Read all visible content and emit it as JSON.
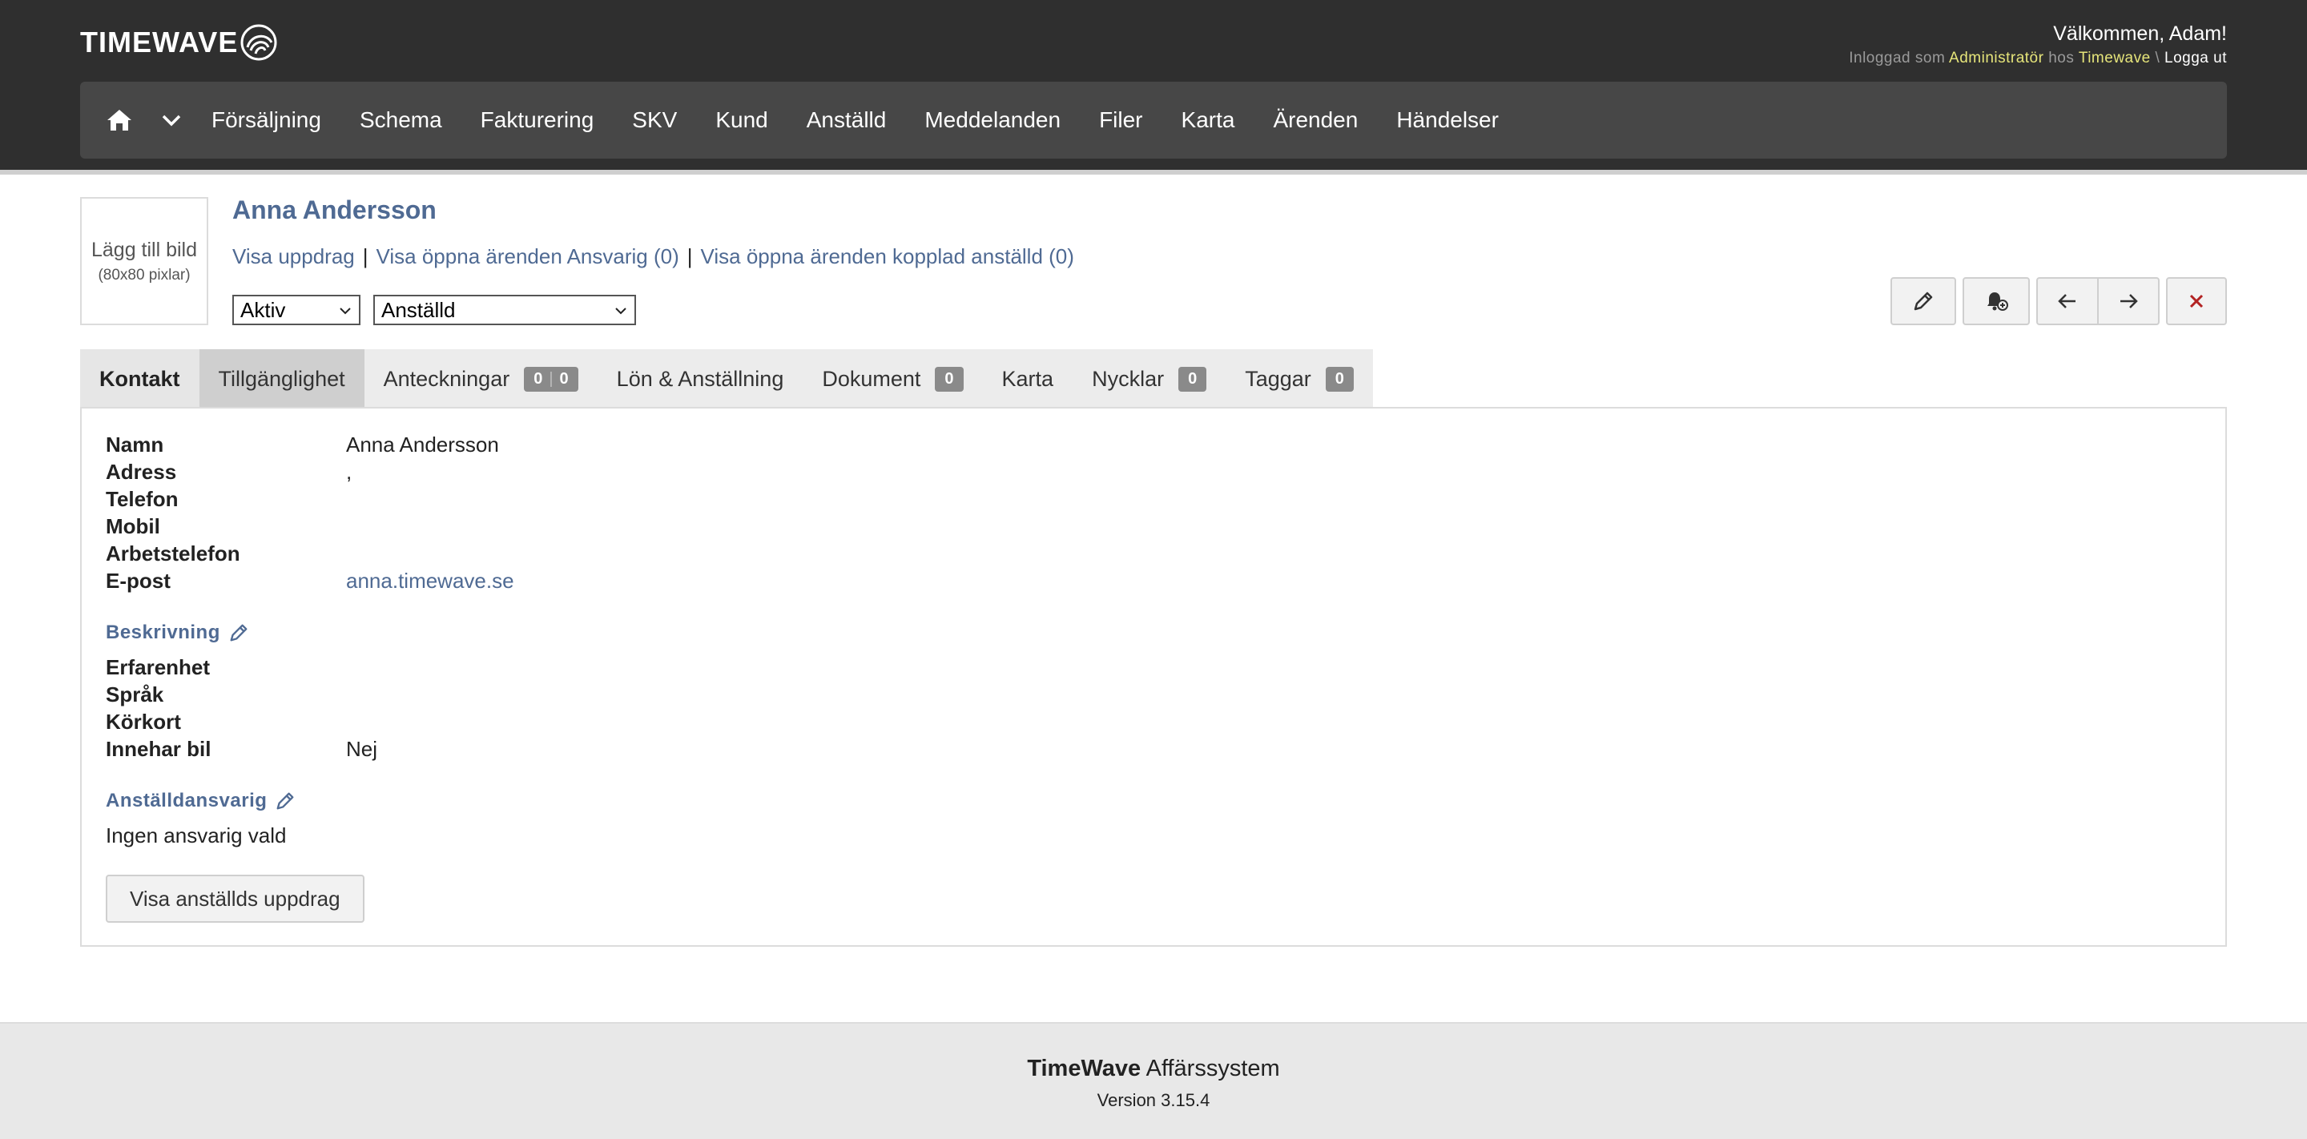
{
  "header": {
    "logo_text": "TIMEWAVE",
    "welcome": "Välkommen, Adam!",
    "login": {
      "prefix": "Inloggad som",
      "role": "Administratör",
      "mid": "hos",
      "company": "Timewave",
      "sep": "\\",
      "logout": "Logga ut"
    }
  },
  "nav": {
    "home_icon": "home-icon",
    "menu_icon": "chevron-down-icon",
    "items": [
      "Försäljning",
      "Schema",
      "Fakturering",
      "SKV",
      "Kund",
      "Anställd",
      "Meddelanden",
      "Filer",
      "Karta",
      "Ärenden",
      "Händelser"
    ]
  },
  "profile": {
    "avatar_label": "Lägg till bild",
    "avatar_hint": "(80x80 pixlar)",
    "name": "Anna Andersson",
    "links": [
      "Visa uppdrag",
      "Visa öppna ärenden Ansvarig (0)",
      "Visa öppna ärenden kopplad anställd (0)"
    ],
    "link_sep": "|",
    "status_select": "Aktiv",
    "role_select": "Anställd"
  },
  "toolbar": {
    "icons": [
      "pencil-icon",
      "bell-plus-icon",
      "arrow-left-icon",
      "arrow-right-icon",
      "close-icon"
    ],
    "close_color": "#b22222"
  },
  "tabs": [
    {
      "label": "Kontakt"
    },
    {
      "label": "Tillgänglighet"
    },
    {
      "label": "Anteckningar",
      "badge_a": "0",
      "badge_sep": "|",
      "badge_b": "0"
    },
    {
      "label": "Lön & Anställning"
    },
    {
      "label": "Dokument",
      "badge": "0"
    },
    {
      "label": "Karta"
    },
    {
      "label": "Nycklar",
      "badge": "0"
    },
    {
      "label": "Taggar",
      "badge": "0"
    }
  ],
  "contact": {
    "fields": [
      {
        "label": "Namn",
        "value": "Anna Andersson"
      },
      {
        "label": "Adress",
        "value": ","
      },
      {
        "label": "Telefon",
        "value": ""
      },
      {
        "label": "Mobil",
        "value": ""
      },
      {
        "label": "Arbetstelefon",
        "value": ""
      },
      {
        "label": "E-post",
        "value": "anna.timewave.se"
      }
    ],
    "description_title": "Beskrivning",
    "description_fields": [
      {
        "label": "Erfarenhet",
        "value": ""
      },
      {
        "label": "Språk",
        "value": ""
      },
      {
        "label": "Körkort",
        "value": ""
      },
      {
        "label": "Innehar bil",
        "value": "Nej"
      }
    ],
    "manager_title": "Anställdansvarig",
    "manager_value": "Ingen ansvarig vald",
    "assignments_button": "Visa anställds uppdrag"
  },
  "footer": {
    "brand_bold": "TimeWave",
    "brand_rest": " Affärssystem",
    "version": "Version 3.15.4"
  },
  "colors": {
    "header_bg": "#2f2f2f",
    "nav_bg": "#474747",
    "link": "#4f6a93",
    "highlight": "#e6e57a"
  }
}
